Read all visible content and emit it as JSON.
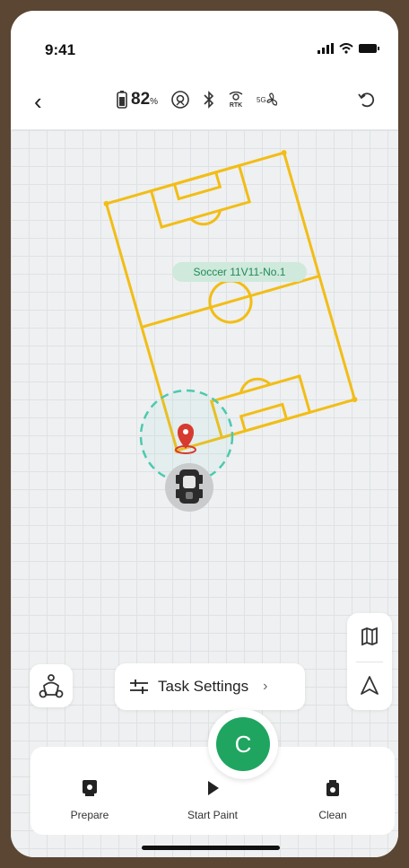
{
  "status_bar": {
    "time": "9:41"
  },
  "top_bar": {
    "battery_value": "82",
    "battery_unit": "%",
    "rtk_label": "RTK",
    "signal_label": "5G"
  },
  "map": {
    "field_label": "Soccer 11V11-No.1"
  },
  "controls": {
    "task_settings_label": "Task Settings",
    "center_button_label": "C"
  },
  "bottom_actions": {
    "prepare_label": "Prepare",
    "start_paint_label": "Start Paint",
    "clean_label": "Clean"
  },
  "colors": {
    "field_line": "#f2bd16",
    "label_bg": "#cfe9dc",
    "label_text": "#1f8a55",
    "accent_green": "#1fa560",
    "pin_red": "#d73a2e",
    "ring_teal": "#4cc9b0"
  }
}
